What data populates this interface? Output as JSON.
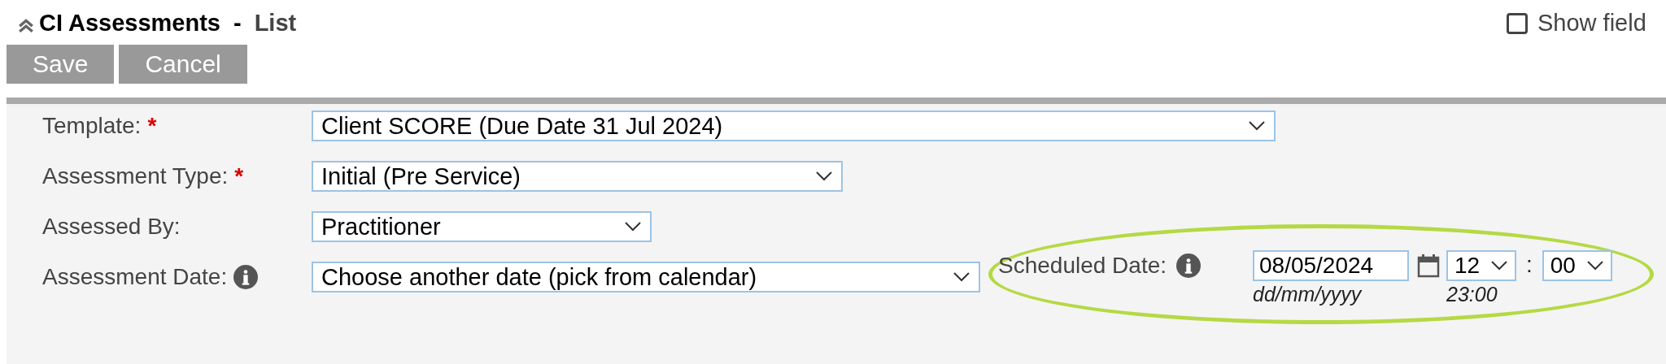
{
  "header": {
    "title": "CI Assessments",
    "separator": "-",
    "subtitle": "List"
  },
  "show_field_option": {
    "label": "Show field",
    "checked": false
  },
  "buttons": [
    "Save",
    "Cancel"
  ],
  "fields": [
    {
      "label": "Template:",
      "required": true,
      "info": false,
      "value": "Client SCORE (Due Date 31 Jul 2024)"
    },
    {
      "label": "Assessment Type:",
      "required": true,
      "info": false,
      "value": "Initial (Pre Service)"
    },
    {
      "label": "Assessed By:",
      "required": false,
      "info": false,
      "value": "Practitioner"
    },
    {
      "label": "Assessment Date:",
      "required": false,
      "info": true,
      "value": "Choose another date (pick from calendar)"
    }
  ],
  "required_mark": "*",
  "scheduled": {
    "label": "Scheduled Date:",
    "info": true,
    "date_value": "08/05/2024",
    "date_hint": "dd/mm/yyyy",
    "hour": "12",
    "time_separator": ":",
    "minute": "00",
    "time_hint": "23:00",
    "highlighted": true
  }
}
